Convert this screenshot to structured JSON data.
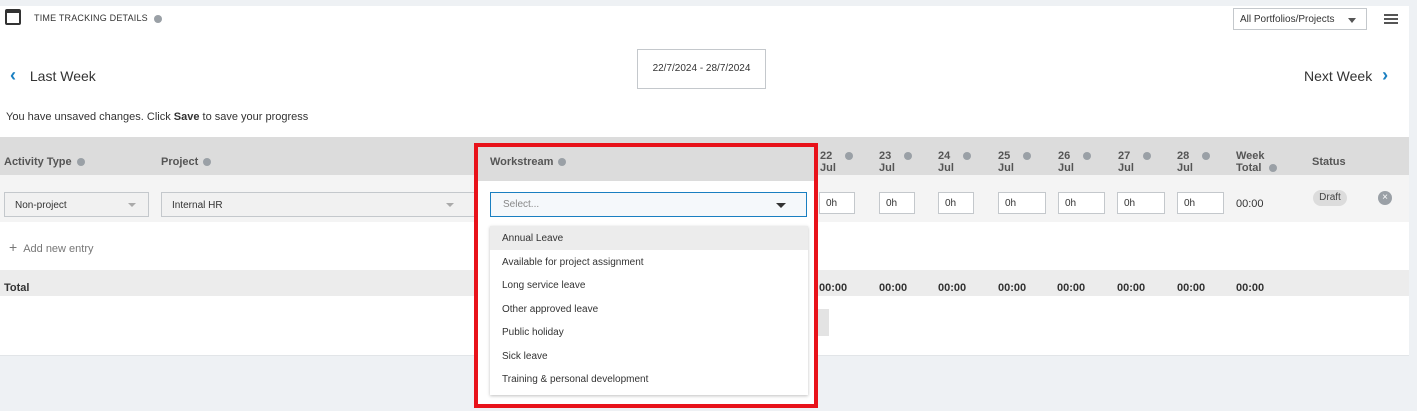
{
  "header": {
    "title": "TIME TRACKING DETAILS",
    "portfolio_filter": "All Portfolios/Projects"
  },
  "nav": {
    "prev_label": "Last Week",
    "next_label": "Next Week",
    "date_range": "22/7/2024 - 28/7/2024"
  },
  "notice": {
    "prefix": "You have unsaved changes. Click ",
    "emph": "Save",
    "suffix": " to save your progress"
  },
  "columns": {
    "activity_type": "Activity Type",
    "project": "Project",
    "workstream": "Workstream",
    "days": [
      {
        "num": "22",
        "mon": "Jul"
      },
      {
        "num": "23",
        "mon": "Jul"
      },
      {
        "num": "24",
        "mon": "Jul"
      },
      {
        "num": "25",
        "mon": "Jul"
      },
      {
        "num": "26",
        "mon": "Jul"
      },
      {
        "num": "27",
        "mon": "Jul"
      },
      {
        "num": "28",
        "mon": "Jul"
      }
    ],
    "week_total_1": "Week",
    "week_total_2": "Total",
    "status": "Status"
  },
  "row": {
    "activity_type": "Non-project",
    "project": "Internal HR",
    "workstream_placeholder": "Select...",
    "hours": [
      "0h",
      "0h",
      "0h",
      "0h",
      "0h",
      "0h",
      "0h"
    ],
    "week_total": "00:00",
    "status": "Draft"
  },
  "add_entry": "Add new entry",
  "totals": {
    "label": "Total",
    "values": [
      "00:00",
      "00:00",
      "00:00",
      "00:00",
      "00:00",
      "00:00",
      "00:00",
      "00:00"
    ]
  },
  "workstream_options": [
    "Annual Leave",
    "Available for project assignment",
    "Long service leave",
    "Other approved leave",
    "Public holiday",
    "Sick leave",
    "Training & personal development"
  ],
  "colors": {
    "accent": "#1a7fc1",
    "highlight_border": "#e8121a"
  }
}
